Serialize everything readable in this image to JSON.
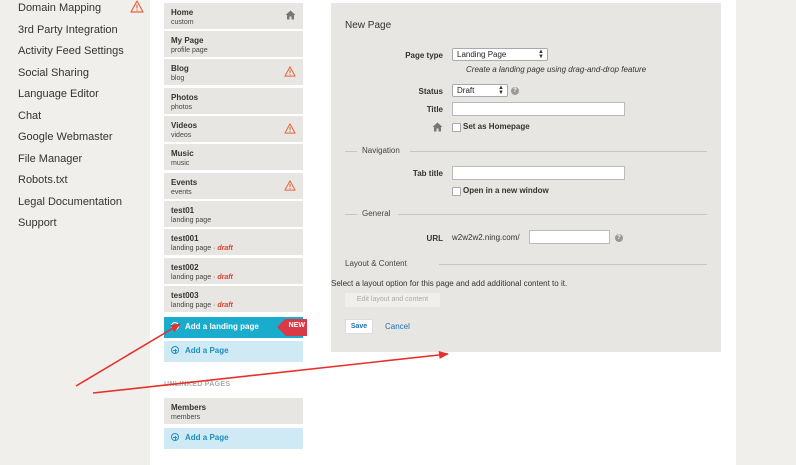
{
  "left_nav": {
    "items": [
      "Domain Mapping",
      "3rd Party Integration",
      "Activity Feed Settings",
      "Social Sharing",
      "Language Editor",
      "Chat",
      "Google Webmaster",
      "File Manager",
      "Robots.txt",
      "Legal Documentation",
      "Support"
    ]
  },
  "pages": [
    {
      "name": "Home",
      "sub": "custom",
      "draft": "",
      "icon": "home-icon"
    },
    {
      "name": "My Page",
      "sub": "profile page",
      "draft": "",
      "icon": ""
    },
    {
      "name": "Blog",
      "sub": "blog",
      "draft": "",
      "icon": "warning-icon"
    },
    {
      "name": "Photos",
      "sub": "photos",
      "draft": "",
      "icon": ""
    },
    {
      "name": "Videos",
      "sub": "videos",
      "draft": "",
      "icon": "warning-icon"
    },
    {
      "name": "Music",
      "sub": "music",
      "draft": "",
      "icon": ""
    },
    {
      "name": "Events",
      "sub": "events",
      "draft": "",
      "icon": "warning-icon"
    },
    {
      "name": "test01",
      "sub": "landing page",
      "draft": "",
      "icon": ""
    },
    {
      "name": "test001",
      "sub": "landing page · ",
      "draft": "draft",
      "icon": ""
    },
    {
      "name": "test002",
      "sub": "landing page · ",
      "draft": "draft",
      "icon": ""
    },
    {
      "name": "test003",
      "sub": "landing page · ",
      "draft": "draft",
      "icon": ""
    }
  ],
  "add_landing_page": {
    "label": "Add a landing page",
    "badge": "NEW"
  },
  "add_page": {
    "label": "Add a Page"
  },
  "unlinked": {
    "heading": "UNLINKED PAGES",
    "pages": [
      {
        "name": "Members",
        "sub": "members"
      }
    ],
    "add_label": "Add a Page"
  },
  "form": {
    "title": "New Page",
    "page_type": {
      "label": "Page type",
      "value": "Landing Page",
      "hint": "Create a landing page using drag-and-drop feature"
    },
    "status": {
      "label": "Status",
      "value": "Draft",
      "help": "?"
    },
    "title_field": {
      "label": "Title",
      "value": ""
    },
    "homepage": {
      "label": "Set as Homepage"
    },
    "navigation": {
      "heading": "Navigation",
      "tab_title": {
        "label": "Tab title",
        "value": ""
      },
      "new_window": {
        "label": "Open in a new window"
      }
    },
    "general": {
      "heading": "General",
      "url": {
        "label": "URL",
        "prefix": "w2w2w2.ning.com/",
        "value": "",
        "help": "?"
      }
    },
    "layout": {
      "heading": "Layout & Content",
      "text": "Select a layout option for this page and add additional content to it.",
      "edit_button": "Edit layout and content"
    },
    "save_label": "Save",
    "cancel_label": "Cancel"
  },
  "colors": {
    "accent": "#1aaccc",
    "new_badge": "#d93a45",
    "draft": "#e0412e",
    "warning": "#e8643c",
    "annotation_arrow": "#e8302a"
  }
}
